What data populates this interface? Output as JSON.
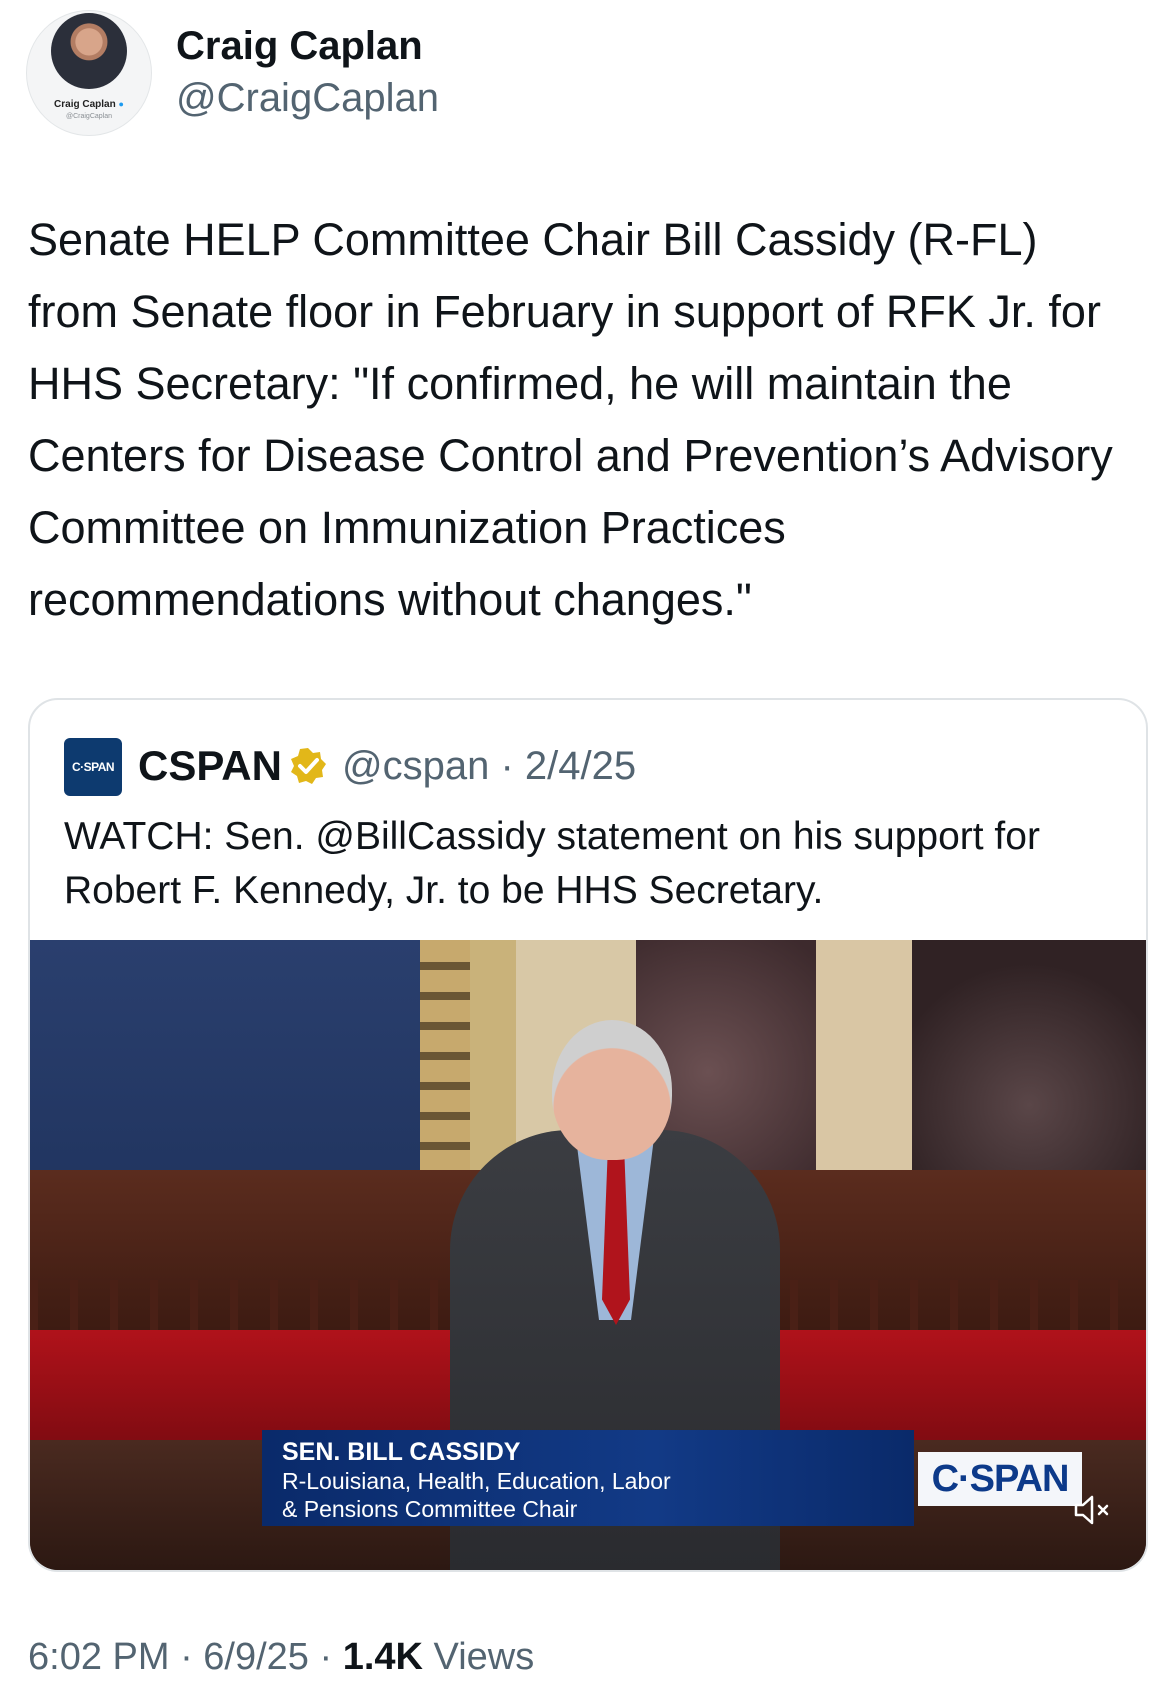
{
  "author": {
    "name": "Craig Caplan",
    "handle": "@CraigCaplan",
    "avatar_caption_name": "Craig Caplan",
    "avatar_caption_handle": "@CraigCaplan"
  },
  "tweet": {
    "text": "Senate HELP Committee Chair Bill Cassidy (R-FL) from Senate floor in February in support of RFK Jr. for HHS Secretary: \"If confirmed, he will maintain the Centers for Disease Control and Prevention’s Advisory Committee on Immunization Practices recommendations without changes.\""
  },
  "quote": {
    "logo_text": "C·SPAN",
    "name": "CSPAN",
    "verified_icon": "gold-verified-badge-icon",
    "handle_date": "@cspan · 2/4/25",
    "text": "WATCH: Sen. @BillCassidy statement on his support for Robert F. Kennedy, Jr. to be HHS Secretary.",
    "video": {
      "lower_third_name": "SEN. BILL CASSIDY",
      "lower_third_line1": "R-Louisiana, Health, Education, Labor",
      "lower_third_line2": "& Pensions Committee Chair",
      "bug_text": "C·SPAN",
      "mute_icon": "speaker-muted-icon"
    }
  },
  "footer": {
    "time_date": "6:02 PM · 6/9/25 · ",
    "views_count": "1.4K",
    "views_label": " Views"
  },
  "colors": {
    "text_primary": "#0f1419",
    "text_secondary": "#536471",
    "border": "#dfe3e6",
    "verified_gold": "#e2b719",
    "cspan_blue": "#0d3a6f"
  }
}
